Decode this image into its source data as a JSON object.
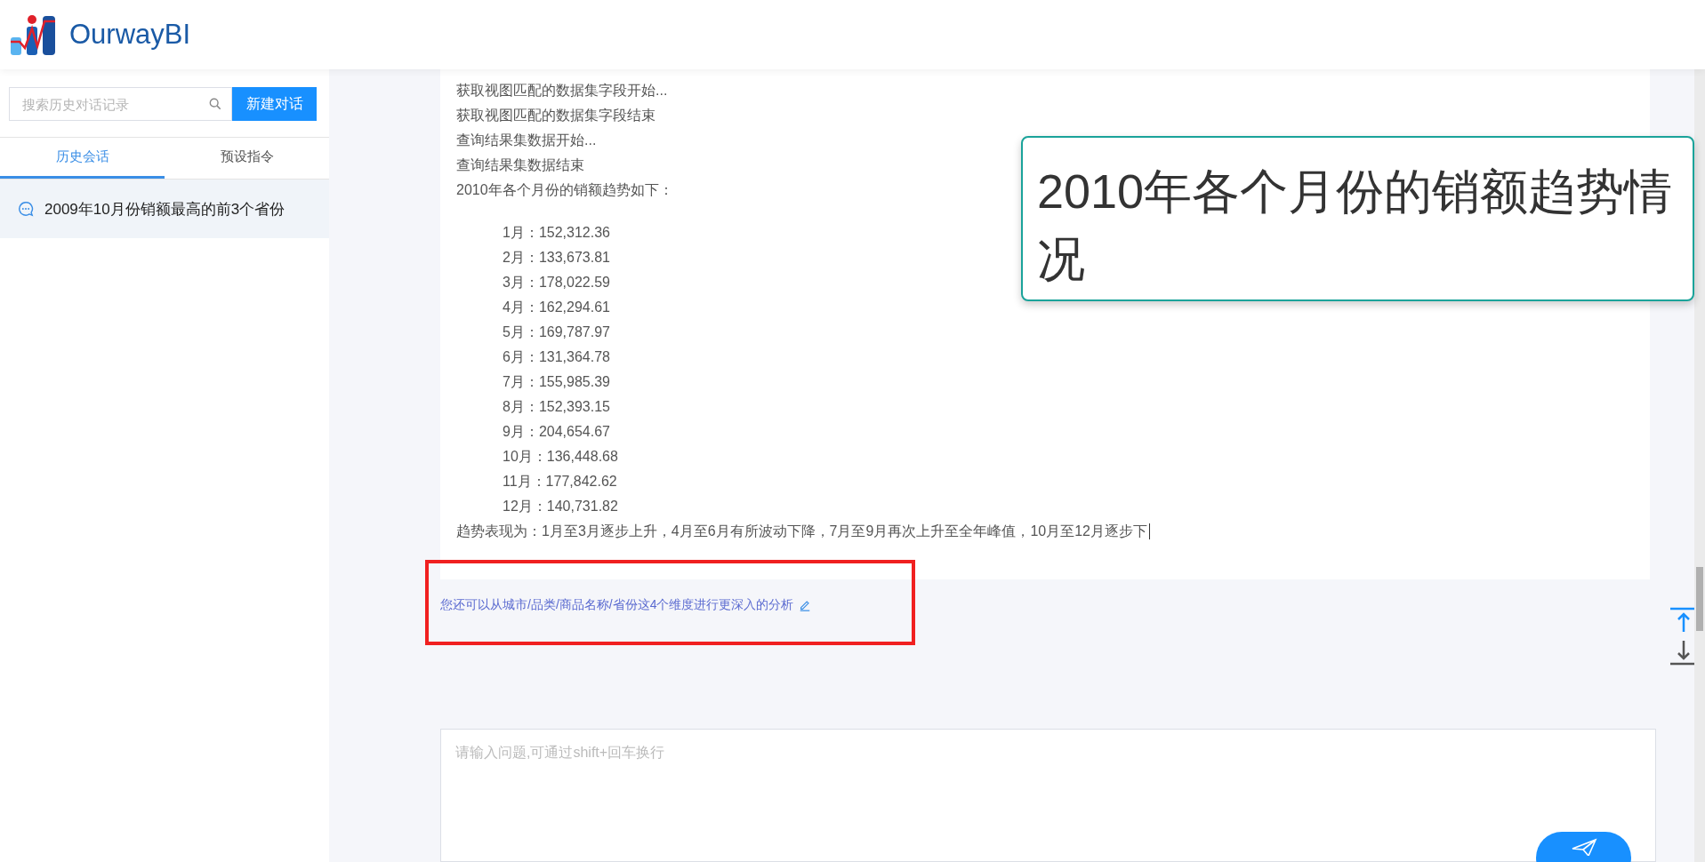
{
  "header": {
    "logo_text": "OurwayBI"
  },
  "sidebar": {
    "search": {
      "placeholder": "搜索历史对话记录"
    },
    "new_button": "新建对话",
    "tabs": [
      {
        "label": "历史会话",
        "selected": true
      },
      {
        "label": "预设指令",
        "selected": false
      }
    ],
    "conversations": [
      {
        "title": "2009年10月份销额最高的前3个省份",
        "selected": true
      }
    ]
  },
  "message": {
    "log_lines": [
      "获取视图匹配的数据集字段开始...",
      "获取视图匹配的数据集字段结束",
      "查询结果集数据开始...",
      "查询结果集数据结束",
      "2010年各个月份的销额趋势如下："
    ],
    "months": [
      "1月：152,312.36",
      "2月：133,673.81",
      "3月：178,022.59",
      "4月：162,294.61",
      "5月：169,787.97",
      "6月：131,364.78",
      "7月：155,985.39",
      "8月：152,393.15",
      "9月：204,654.67",
      "10月：136,448.68",
      "11月：177,842.62",
      "12月：140,731.82"
    ],
    "summary": "趋势表现为：1月至3月逐步上升，4月至6月有所波动下降，7月至9月再次上升至全年峰值，10月至12月逐步下",
    "typing": true
  },
  "suggestion": {
    "text": "您还可以从城市/品类/商品名称/省份这4个维度进行更深入的分析"
  },
  "input": {
    "placeholder": "请输入问题,可通过shift+回车换行"
  },
  "annotations": {
    "callout": "2010年各个月份的销额趋势情况",
    "highlight": true
  }
}
